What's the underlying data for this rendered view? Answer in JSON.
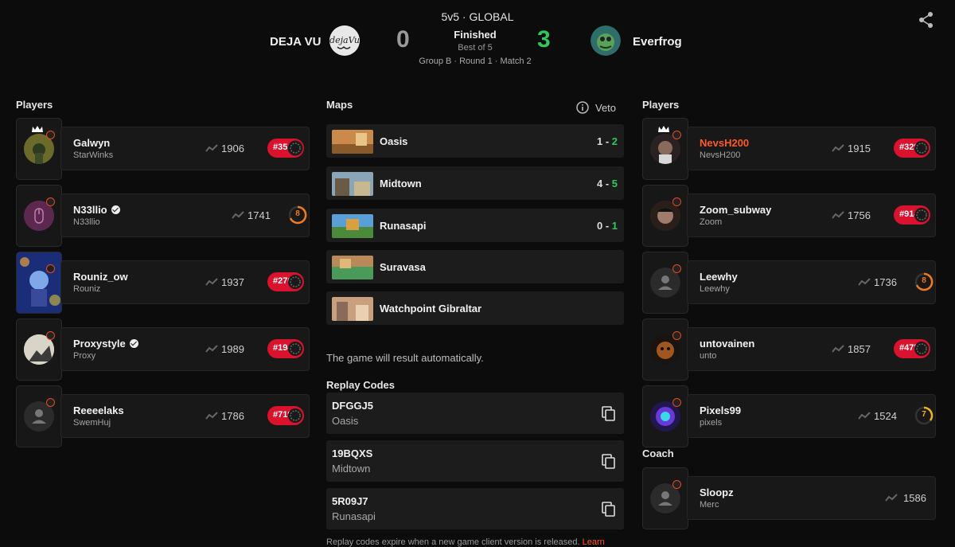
{
  "match": {
    "mode": "5v5 · GLOBAL",
    "status": "Finished",
    "best_of": "Best of 5",
    "stage": "Group B · Round 1 · Match 2",
    "team1": {
      "name": "DEJA VU",
      "score": "0"
    },
    "team2": {
      "name": "Everfrog",
      "score": "3"
    }
  },
  "left": {
    "heading": "Players",
    "players": [
      {
        "name": "Galwyn",
        "sub": "StarWinks",
        "rating": "1906",
        "rank": "#351"
      },
      {
        "name": "N33llio",
        "sub": "N33llio",
        "rating": "1741",
        "level": "8"
      },
      {
        "name": "Rouniz_ow",
        "sub": "Rouniz",
        "rating": "1937",
        "rank": "#276"
      },
      {
        "name": "Proxystyle",
        "sub": "Proxy",
        "rating": "1989",
        "rank": "#194"
      },
      {
        "name": "Reeeelaks",
        "sub": "SwemHuj",
        "rating": "1786",
        "rank": "#719"
      }
    ]
  },
  "maps": {
    "heading": "Maps",
    "veto_label": "Veto",
    "list": [
      {
        "name": "Oasis",
        "s1": "1",
        "s2": "2"
      },
      {
        "name": "Midtown",
        "s1": "4",
        "s2": "5"
      },
      {
        "name": "Runasapi",
        "s1": "0",
        "s2": "1"
      },
      {
        "name": "Suravasa"
      },
      {
        "name": "Watchpoint Gibraltar"
      }
    ],
    "auto_note": "The game will result automatically."
  },
  "replay": {
    "heading": "Replay Codes",
    "codes": [
      {
        "code": "DFGGJ5",
        "map": "Oasis"
      },
      {
        "code": "19BQXS",
        "map": "Midtown"
      },
      {
        "code": "5R09J7",
        "map": "Runasapi"
      }
    ],
    "note": "Replay codes expire when a new game client version is released.",
    "learn": "Learn"
  },
  "right": {
    "heading": "Players",
    "players": [
      {
        "name": "NevsH200",
        "sub": "NevsH200",
        "rating": "1915",
        "rank": "#329"
      },
      {
        "name": "Zoom_subway",
        "sub": "Zoom",
        "rating": "1756",
        "rank": "#914"
      },
      {
        "name": "Leewhy",
        "sub": "Leewhy",
        "rating": "1736",
        "level": "8"
      },
      {
        "name": "untovainen",
        "sub": "unto",
        "rating": "1857",
        "rank": "#475"
      },
      {
        "name": "Pixels99",
        "sub": "pixels",
        "rating": "1524",
        "level": "7"
      }
    ],
    "coach_heading": "Coach",
    "coach": {
      "name": "Sloopz",
      "sub": "Merc",
      "rating": "1586"
    }
  },
  "colors": {
    "win": "#31c75a",
    "rank_badge": "#d9122e",
    "highlight": "#ff5a2a",
    "level_8": "#f07a1e",
    "level_7": "#f0b41e"
  }
}
